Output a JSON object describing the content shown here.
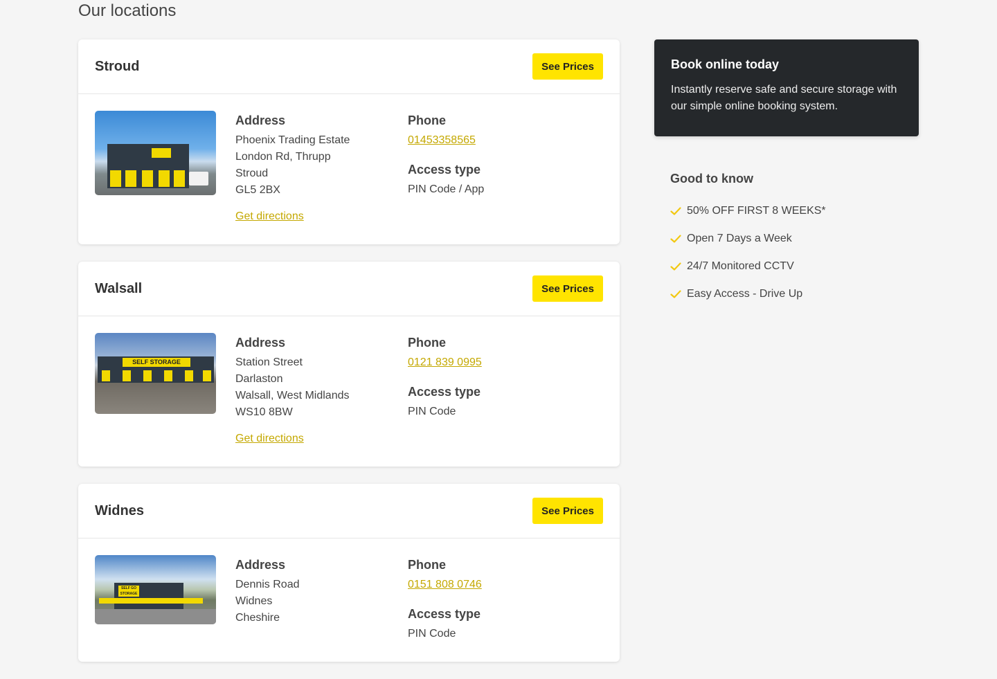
{
  "page": {
    "title": "Our locations"
  },
  "locations": [
    {
      "name": "Stroud",
      "see_prices": "See Prices",
      "address_label": "Address",
      "address": [
        "Phoenix Trading Estate",
        "London Rd, Thrupp",
        "Stroud",
        "GL5 2BX"
      ],
      "directions": "Get directions",
      "phone_label": "Phone",
      "phone": "01453358565",
      "access_label": "Access type",
      "access": "PIN Code / App"
    },
    {
      "name": "Walsall",
      "see_prices": "See Prices",
      "address_label": "Address",
      "address": [
        "Station Street",
        "Darlaston",
        "Walsall, West Midlands",
        "WS10 8BW"
      ],
      "directions": "Get directions",
      "phone_label": "Phone",
      "phone": "0121 839 0995",
      "access_label": "Access type",
      "access": "PIN Code"
    },
    {
      "name": "Widnes",
      "see_prices": "See Prices",
      "address_label": "Address",
      "address": [
        "Dennis Road",
        "Widnes",
        "Cheshire"
      ],
      "phone_label": "Phone",
      "phone": "0151 808 0746",
      "access_label": "Access type",
      "access": "PIN Code"
    }
  ],
  "sidebar": {
    "book_title": "Book online today",
    "book_text": "Instantly reserve safe and secure storage with our simple online booking system.",
    "know_title": "Good to know",
    "know_items": [
      "50% OFF FIRST 8 WEEKS*",
      "Open 7 Days a Week",
      "24/7 Monitored CCTV",
      "Easy Access - Drive Up"
    ]
  },
  "photo_text": {
    "walsall_sign": "SELF STORAGE",
    "widnes_sign": "SELF GO STORAGE"
  },
  "colors": {
    "accent": "#ffe400",
    "link": "#c4a800",
    "dark_panel": "#25282b",
    "background": "#f5f5f5",
    "check": "#f2c811"
  },
  "icons": {
    "check": "check-icon"
  }
}
